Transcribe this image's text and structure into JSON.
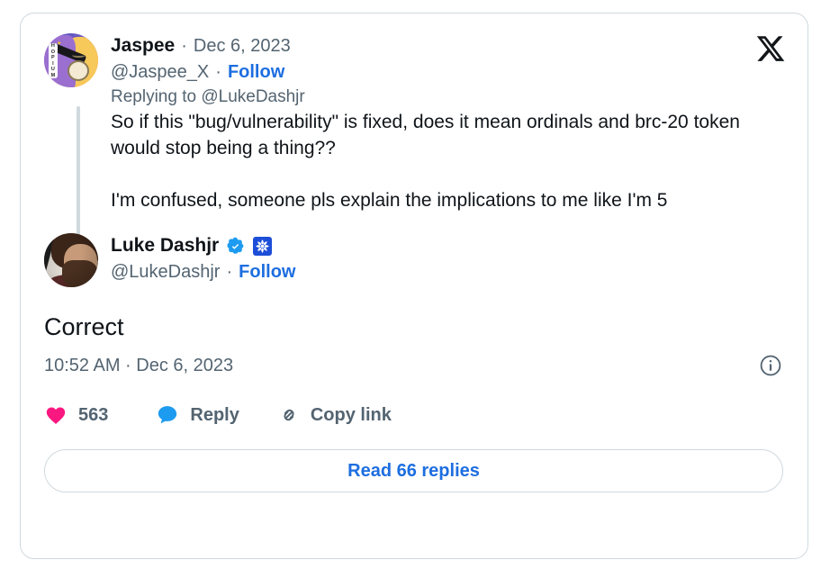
{
  "card": {
    "brand_logo": "x-logo",
    "accent_link_color": "#1d6ee0",
    "text_color": "#0f1419",
    "muted_text_color": "#536471",
    "border_color": "#cfd9de",
    "like_color": "#f91880",
    "reply_color": "#1d9bf0",
    "verified_color": "#1d9bf0",
    "affiliate_badge_color": "#1d4ed8"
  },
  "tweets": [
    {
      "avatar": "jaspee-cartoon-avatar",
      "display_name": "Jaspee",
      "separator": "·",
      "date": "Dec 6, 2023",
      "handle": "@Jaspee_X",
      "follow_label": "Follow",
      "replying_to": "Replying to @LukeDashjr",
      "avatar_label_letters": [
        "H",
        "O",
        "P",
        "I",
        "U",
        "M"
      ],
      "body_lines": [
        "So if this \"bug/vulnerability\" is fixed, does it mean ordinals and brc-20 token would stop being a thing??",
        "",
        "I'm confused, someone pls explain the implications to me like I'm 5"
      ]
    },
    {
      "avatar": "luke-dashjr-photo-avatar",
      "display_name": "Luke Dashjr",
      "separator": "·",
      "handle": "@LukeDashjr",
      "follow_label": "Follow",
      "verified_badge": "verified-check-icon",
      "affiliate_badge": "affiliate-pinwheel-icon",
      "main_text": "Correct",
      "timestamp": "10:52 AM · Dec 6, 2023",
      "info_icon": "info-circle-icon"
    }
  ],
  "actions": {
    "like": {
      "icon": "heart-icon",
      "count": "563"
    },
    "reply": {
      "icon": "speech-bubble-icon",
      "label": "Reply"
    },
    "copy_link": {
      "icon": "chain-link-icon",
      "label": "Copy link"
    }
  },
  "read_replies": {
    "label": "Read 66 replies"
  }
}
